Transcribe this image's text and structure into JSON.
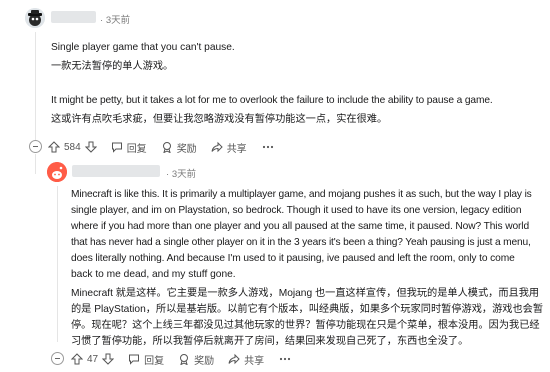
{
  "comment1": {
    "time": "3天前",
    "lines": [
      "Single player game that you can't pause.",
      "一款无法暂停的单人游戏。",
      "It might be petty, but it takes a lot for me to overlook the failure to include the ability to pause a game.",
      "这或许有点吹毛求疵，但要让我忽略游戏没有暂停功能这一点，实在很难。"
    ],
    "vote_count": "584",
    "reply_label": "回复",
    "award_label": "奖励",
    "share_label": "共享"
  },
  "comment2": {
    "time": "3天前",
    "en_lines": [
      "Minecraft is like this. It is primarily a multiplayer game, and mojang pushes it as such, but the way I play is",
      "single player, and im on Playstation, so bedrock. Though it used to have its one version, legacy edition",
      "where if you had more than one player and you all paused at the same time, it paused. Now? This world",
      "that has never had a single other player on it in the 3 years it's been a thing? Yeah pausing is just a menu,",
      "does literally nothing. And because I'm used to it pausing, ive paused and left the room, only to come",
      "back to me dead, and my stuff gone."
    ],
    "cn_lines": [
      "Minecraft 就是这样。它主要是一款多人游戏，Mojang 也一直这样宣传，但我玩的是单人模式，而且我用",
      "的是 PlayStation，所以是基岩版。以前它有个版本，叫经典版，如果多个玩家同时暂停游戏，游戏也会暂",
      "停。现在呢？这个上线三年都没见过其他玩家的世界？暂停功能现在只是个菜单，根本没用。因为我已经",
      "习惯了暂停功能，所以我暂停后就离开了房间，结果回来发现自己死了，东西也全没了。"
    ],
    "vote_count": "47",
    "reply_label": "回复",
    "award_label": "奖励",
    "share_label": "共享"
  },
  "colors": {
    "text": "#1a1a1b",
    "meta": "#7c7c7c",
    "redacted": "#e4e6e8",
    "avatar2": "#ff4f3b"
  }
}
